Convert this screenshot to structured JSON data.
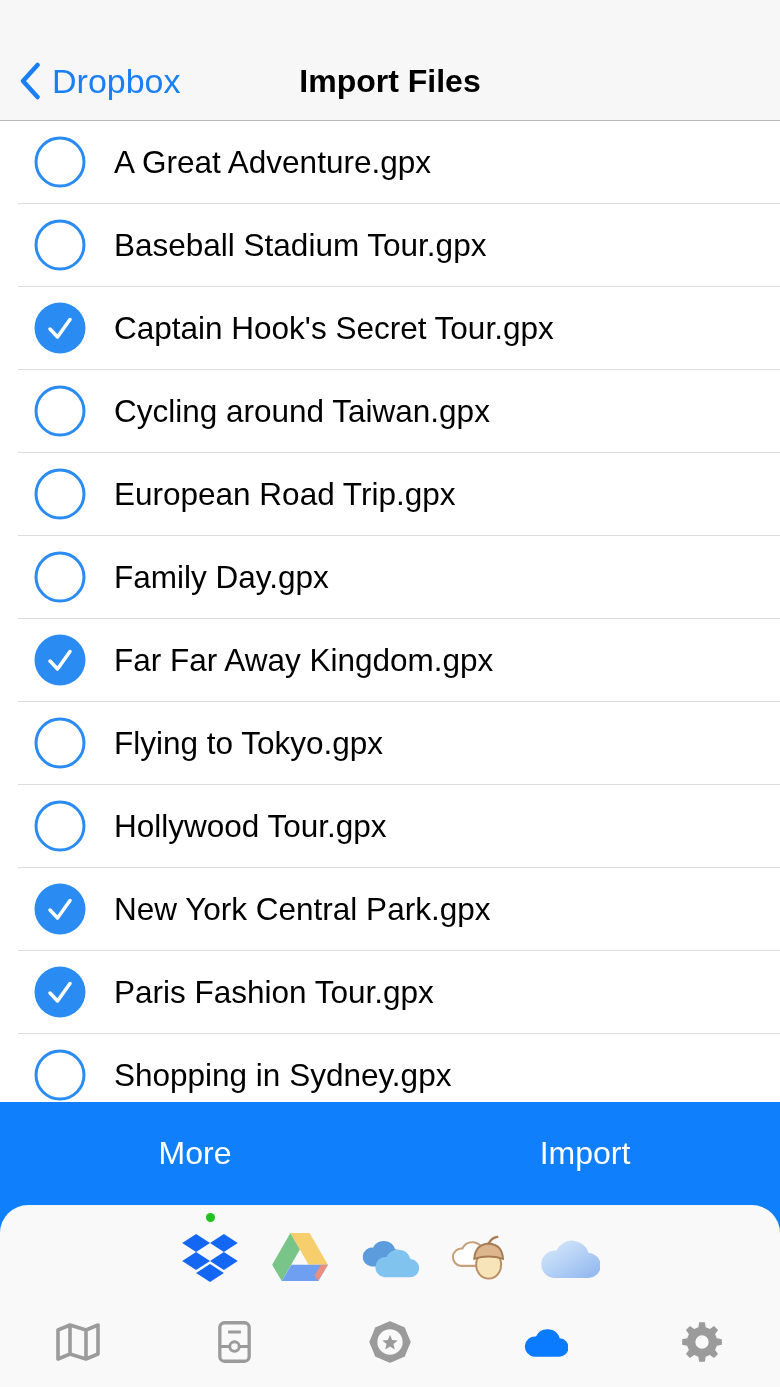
{
  "nav": {
    "back": "Dropbox",
    "title": "Import Files"
  },
  "files": [
    {
      "name": "A Great Adventure.gpx",
      "checked": false
    },
    {
      "name": "Baseball Stadium Tour.gpx",
      "checked": false
    },
    {
      "name": "Captain Hook's Secret Tour.gpx",
      "checked": true
    },
    {
      "name": "Cycling around Taiwan.gpx",
      "checked": false
    },
    {
      "name": "European Road Trip.gpx",
      "checked": false
    },
    {
      "name": "Family Day.gpx",
      "checked": false
    },
    {
      "name": "Far Far Away Kingdom.gpx",
      "checked": true
    },
    {
      "name": "Flying to Tokyo.gpx",
      "checked": false
    },
    {
      "name": "Hollywood Tour.gpx",
      "checked": false
    },
    {
      "name": "New York Central Park.gpx",
      "checked": true
    },
    {
      "name": "Paris Fashion Tour.gpx",
      "checked": true
    },
    {
      "name": "Shopping in Sydney.gpx",
      "checked": false
    }
  ],
  "actions": [
    "More",
    "Import"
  ],
  "providers": [
    {
      "kind": "dropbox",
      "selected": true
    },
    {
      "kind": "drive",
      "selected": false
    },
    {
      "kind": "onedrive",
      "selected": false
    },
    {
      "kind": "nut",
      "selected": false
    },
    {
      "kind": "icloud",
      "selected": false
    }
  ],
  "tabs": [
    {
      "kind": "map",
      "selected": false
    },
    {
      "kind": "device",
      "selected": false
    },
    {
      "kind": "badge",
      "selected": false
    },
    {
      "kind": "cloud",
      "selected": true
    },
    {
      "kind": "gear",
      "selected": false
    }
  ]
}
